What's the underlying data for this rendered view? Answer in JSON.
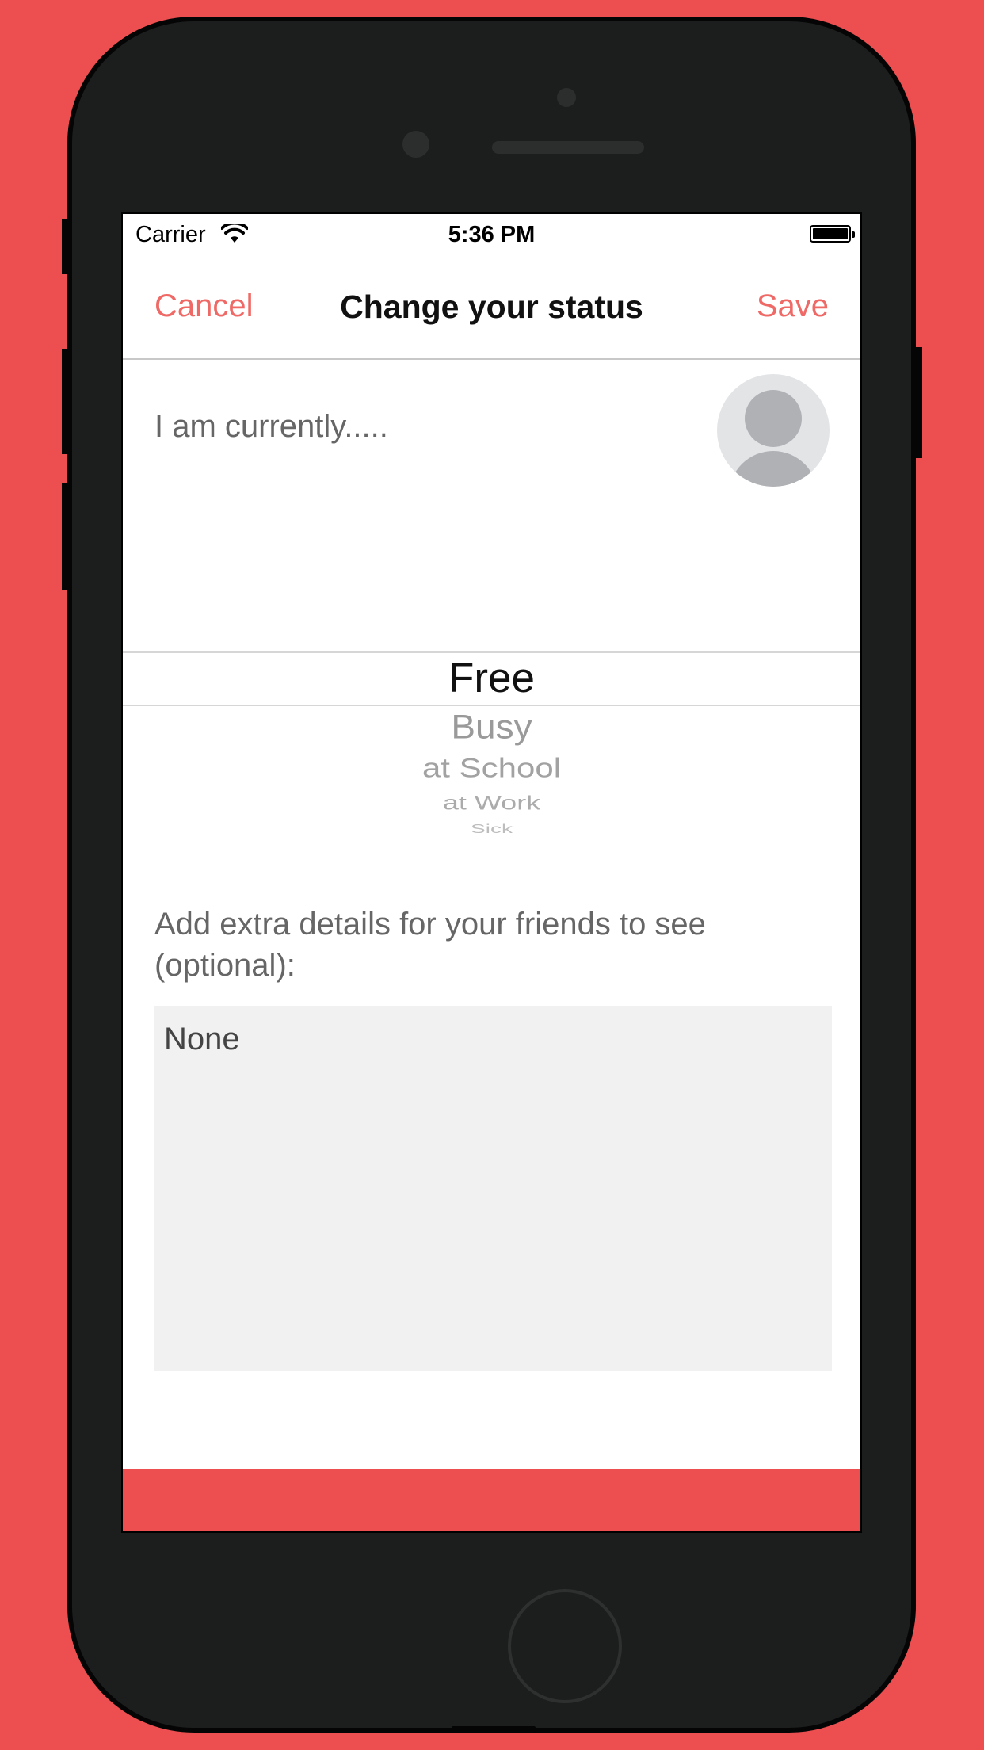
{
  "status_bar": {
    "carrier": "Carrier",
    "time": "5:36 PM",
    "wifi_icon": "wifi-icon",
    "battery_icon": "battery-icon"
  },
  "nav": {
    "cancel_label": "Cancel",
    "title": "Change your status",
    "save_label": "Save"
  },
  "current": {
    "label": "I am currently.....",
    "avatar_icon": "avatar-placeholder-icon"
  },
  "picker": {
    "selected": "Free",
    "items": [
      "Free",
      "Busy",
      "at School",
      "at Work",
      "Sick"
    ]
  },
  "details": {
    "label": "Add extra details for your friends to see (optional):",
    "value": "None"
  },
  "colors": {
    "background": "#ed4e50",
    "accent": "#ef6a66",
    "phone_body": "#1c1e1e",
    "details_box": "#f1f1f1"
  }
}
